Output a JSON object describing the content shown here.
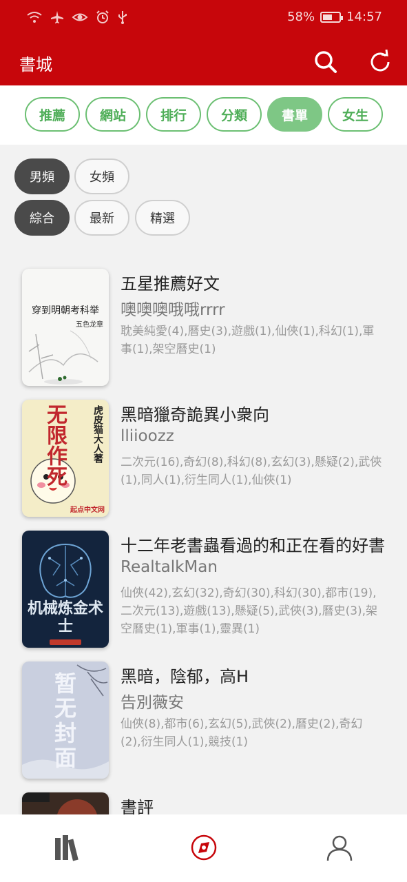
{
  "status": {
    "battery": "58%",
    "battery_level": 0.58,
    "time": "14:57",
    "icons": [
      "wifi-icon",
      "airplane-icon",
      "eye-icon",
      "alarm-icon",
      "usb-icon"
    ]
  },
  "appbar": {
    "title": "書城",
    "icons": [
      "search-icon",
      "refresh-icon"
    ],
    "color": "#c7060b"
  },
  "tabs": [
    {
      "label": "推薦",
      "active": false
    },
    {
      "label": "網站",
      "active": false
    },
    {
      "label": "排行",
      "active": false
    },
    {
      "label": "分類",
      "active": false
    },
    {
      "label": "書單",
      "active": true
    },
    {
      "label": "女生",
      "active": false
    }
  ],
  "filters": {
    "gender": [
      {
        "label": "男頻",
        "selected": true
      },
      {
        "label": "女頻",
        "selected": false
      }
    ],
    "sort": [
      {
        "label": "綜合",
        "selected": true
      },
      {
        "label": "最新",
        "selected": false
      },
      {
        "label": "精選",
        "selected": false
      }
    ]
  },
  "books": [
    {
      "title": "五星推薦好文",
      "author": "噢噢噢哦哦rrrr",
      "tags": "耽美純愛(4),曆史(3),遊戲(1),仙俠(1),科幻(1),軍事(1),架空曆史(1)",
      "cover_title": "穿到明朝考科举",
      "cover_author": "五色龙章"
    },
    {
      "title": "黑暗獵奇詭異小衆向",
      "author": "lliioozz",
      "tags": "二次元(16),奇幻(8),科幻(8),玄幻(3),懸疑(2),武俠(1),同人(1),衍生同人(1),仙俠(1)",
      "cover_title": "无限作死",
      "cover_author": "虎皮猫大人著",
      "cover_brand": "起点中文网"
    },
    {
      "title": "十二年老書蟲看過的和正在看的好書",
      "author": "RealtalkMan",
      "tags": "仙俠(42),玄幻(32),奇幻(30),科幻(30),都市(19),二次元(13),遊戲(13),懸疑(5),武俠(3),曆史(3),架空曆史(1),軍事(1),靈異(1)",
      "cover_title": "机械炼金术士"
    },
    {
      "title": "黑暗，陰郁，高H",
      "author": "告別薇安",
      "tags": "仙俠(8),都市(6),玄幻(5),武俠(2),曆史(2),奇幻(2),衍生同人(1),競技(1)",
      "cover_title": "暂无封面"
    },
    {
      "title": "書評",
      "author": "",
      "tags": ""
    }
  ],
  "bottom_nav": [
    "bookshelf-icon",
    "discover-icon",
    "profile-icon"
  ]
}
